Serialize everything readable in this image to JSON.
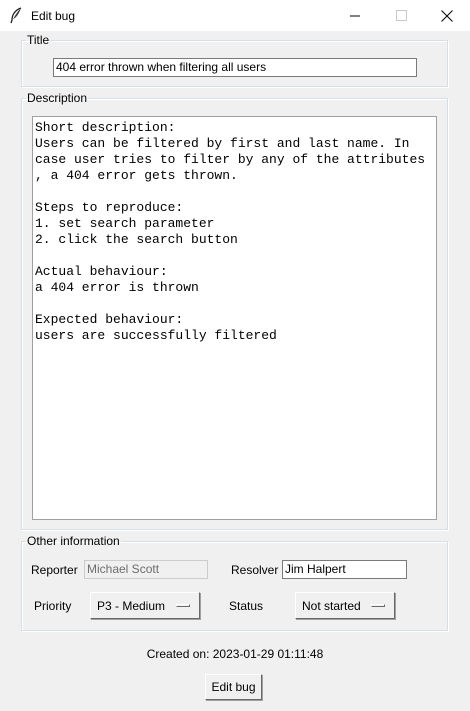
{
  "window": {
    "title": "Edit bug",
    "app_icon": "feather-icon",
    "controls": [
      "minimize-icon",
      "maximize-icon",
      "close-icon"
    ]
  },
  "title_section": {
    "legend": "Title",
    "value": "404 error thrown when filtering all users"
  },
  "description_section": {
    "legend": "Description",
    "text": "Short description:\nUsers can be filtered by first and last name. In\ncase user tries to filter by any of the attributes\n, a 404 error gets thrown.\n\nSteps to reproduce:\n1. set search parameter\n2. click the search button\n\nActual behaviour:\na 404 error is thrown\n\nExpected behaviour:\nusers are successfully filtered"
  },
  "other_section": {
    "legend": "Other information",
    "reporter_label": "Reporter",
    "reporter_value": "Michael Scott",
    "resolver_label": "Resolver",
    "resolver_value": "Jim Halpert",
    "priority_label": "Priority",
    "priority_value": "P3 - Medium",
    "status_label": "Status",
    "status_value": "Not started"
  },
  "footer": {
    "created": "Created on: 2023-01-29 01:11:48",
    "edit_button": "Edit bug"
  },
  "colors": {
    "window_bg": "#f0f0f0",
    "titlebar_bg": "#ffffff",
    "disabled_text": "#6d6d6d"
  }
}
